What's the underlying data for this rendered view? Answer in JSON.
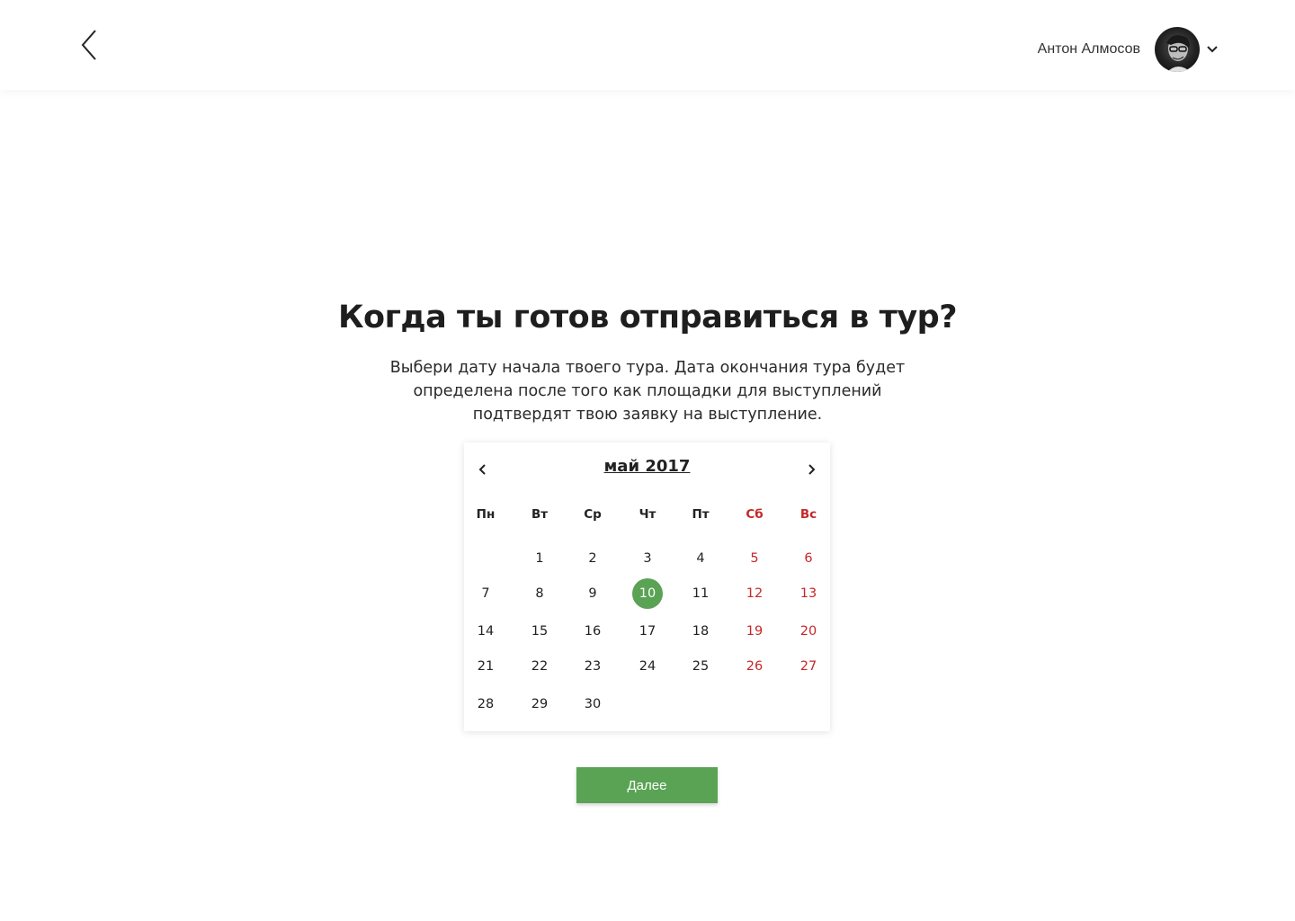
{
  "header": {
    "user_name": "Антон Алмосов"
  },
  "main": {
    "title": "Когда ты готов отправиться в тур?",
    "subtitle": "Выбери дату начала твоего тура. Дата окончания тура будет определена после того как площадки для выступлений подтвердят твою заявку на выступление."
  },
  "calendar": {
    "month_label": "май 2017",
    "weekdays": [
      "Пн",
      "Вт",
      "Ср",
      "Чт",
      "Пт",
      "Сб",
      "Вс"
    ],
    "first_weekday_index": 1,
    "days_in_month": 30,
    "selected_day": 10,
    "weekend_color": "#c62828",
    "selected_color": "#5aa354"
  },
  "footer": {
    "next_label": "Далее"
  },
  "icons": {
    "back": "back-arrow-icon",
    "dropdown": "chevron-down-icon",
    "prev_month": "chevron-left-icon",
    "next_month": "chevron-right-icon"
  },
  "colors": {
    "accent": "#5aa354",
    "weekend": "#c62828"
  }
}
